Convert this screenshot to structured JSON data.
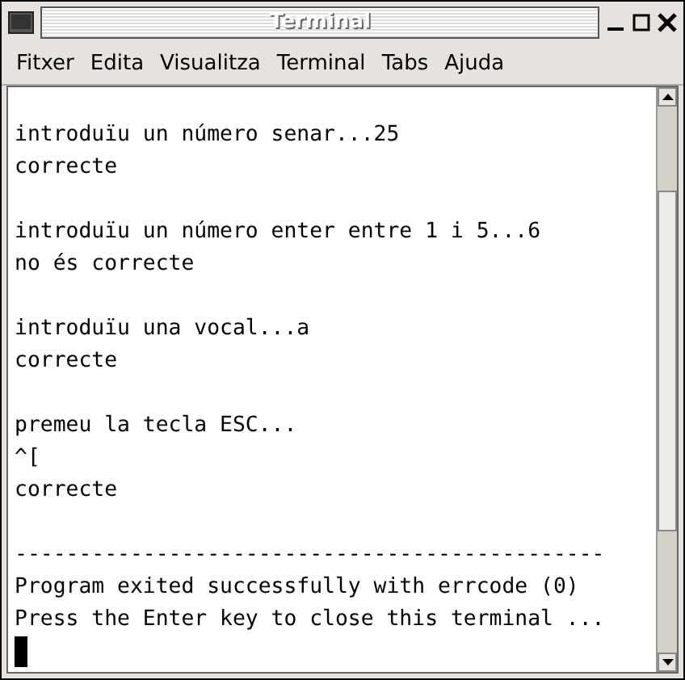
{
  "window": {
    "title": "Terminal"
  },
  "menu": [
    "Fitxer",
    "Edita",
    "Visualitza",
    "Terminal",
    "Tabs",
    "Ajuda"
  ],
  "terminal": {
    "blocks": [
      [
        "introduïu un número senar...25",
        "correcte"
      ],
      [
        "introduïu un número enter entre 1 i 5...6",
        "no és correcte"
      ],
      [
        "introduïu una vocal...a",
        "correcte"
      ],
      [
        "premeu la tecla ESC...",
        "^[",
        "correcte"
      ],
      [
        "----------------------------------------------",
        "Program exited successfully with errcode (0)",
        "Press the Enter key to close this terminal ..."
      ]
    ],
    "cursor": true
  }
}
